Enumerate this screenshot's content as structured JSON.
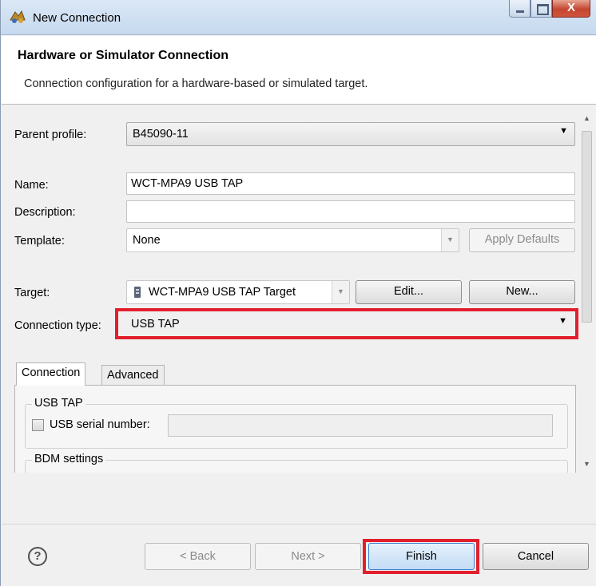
{
  "window": {
    "title": "New Connection",
    "controls": {
      "minimize": "—",
      "maximize": "□",
      "close": "X"
    }
  },
  "header": {
    "title": "Hardware or Simulator Connection",
    "description": "Connection configuration for a hardware-based or simulated target."
  },
  "form": {
    "parent_profile": {
      "label": "Parent profile:",
      "value": "B45090-11"
    },
    "name": {
      "label": "Name:",
      "value": "WCT-MPA9 USB TAP"
    },
    "description": {
      "label": "Description:",
      "value": ""
    },
    "template": {
      "label": "Template:",
      "value": "None",
      "apply_defaults_label": "Apply Defaults"
    },
    "target": {
      "label": "Target:",
      "value": "WCT-MPA9 USB TAP Target",
      "edit_label": "Edit...",
      "new_label": "New..."
    },
    "connection_type": {
      "label": "Connection type:",
      "value": "USB TAP"
    }
  },
  "tabs": [
    {
      "label": "Connection",
      "active": true
    },
    {
      "label": "Advanced",
      "active": false
    }
  ],
  "connection_tab": {
    "usb_tap_group": "USB TAP",
    "usb_serial_label": "USB serial number:",
    "usb_serial_value": "",
    "bdm_group": "BDM settings"
  },
  "footer": {
    "back_label": "< Back",
    "next_label": "Next >",
    "finish_label": "Finish",
    "cancel_label": "Cancel"
  },
  "colors": {
    "highlight": "#e21f2d",
    "accent": "#3c7fd1"
  }
}
